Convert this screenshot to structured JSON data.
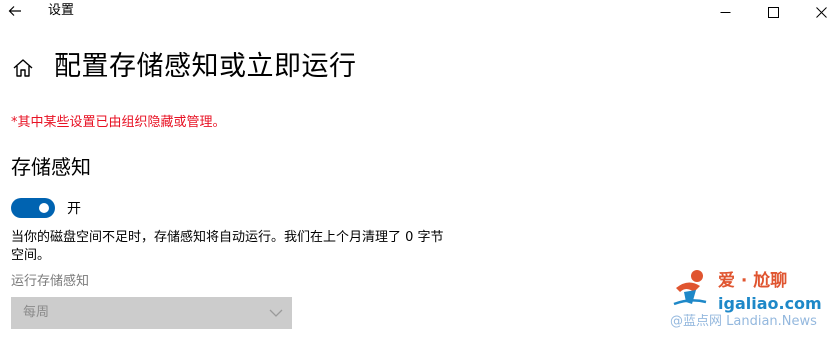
{
  "window": {
    "app_title": "设置",
    "back_icon": "back-arrow-icon",
    "controls": {
      "minimize_icon": "minimize-icon",
      "maximize_icon": "maximize-icon",
      "close_icon": "close-icon"
    }
  },
  "page": {
    "home_icon": "home-icon",
    "title": "配置存储感知或立即运行",
    "policy_warning": "*其中某些设置已由组织隐藏或管理。"
  },
  "storage_sense": {
    "section_title": "存储感知",
    "toggle": {
      "state": "on",
      "label": "开",
      "accent_color": "#0063b1"
    },
    "description": "当你的磁盘空间不足时，存储感知将自动运行。我们在上个月清理了 0 字节 空间。",
    "run_label": "运行存储感知",
    "run_select": {
      "value": "每周",
      "chevron_icon": "chevron-down-icon",
      "disabled": true
    }
  },
  "watermark": {
    "logo_icon": "mascot-logo-icon",
    "text_cn": "爱 · 尬聊",
    "domain": "igaliao.com",
    "subtext": "@蓝点网 Landian.News"
  },
  "colors": {
    "warning": "#e81123",
    "accent": "#0063b1",
    "disabled_field": "#cccccc"
  }
}
